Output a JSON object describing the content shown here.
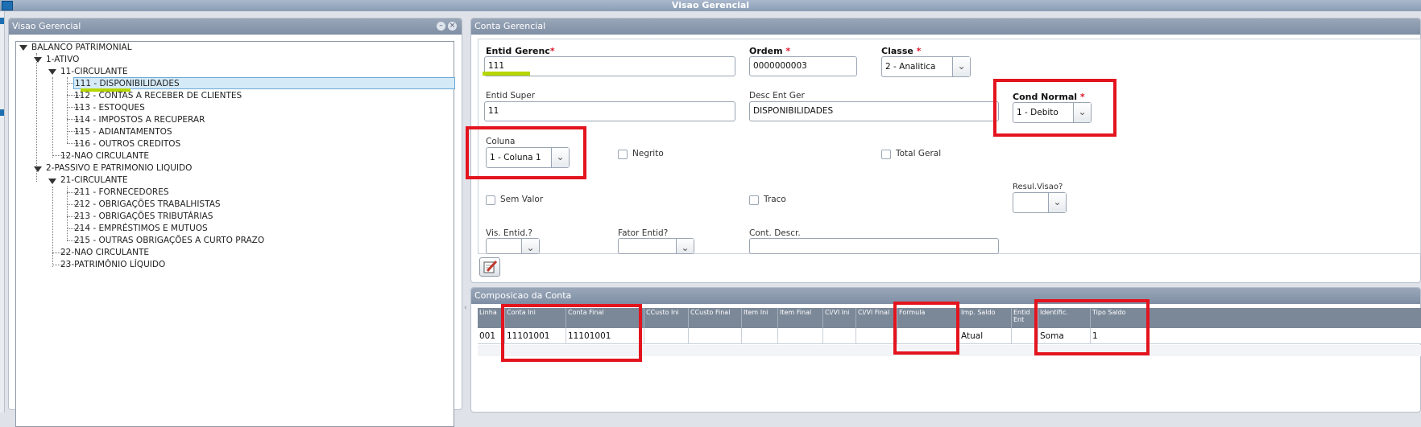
{
  "window": {
    "title": "Visao Gerencial"
  },
  "left_panel": {
    "title": "Visao Gerencial",
    "btn_min": "–",
    "btn_close": "×"
  },
  "tree": {
    "root": "BALANCO PATRIMONIAL",
    "n1": "1-ATIVO",
    "n11": "11-CIRCULANTE",
    "n111": "111 - DISPONIBILIDADES",
    "n112": "112 - CONTAS A RECEBER DE CLIENTES",
    "n113": "113 - ESTOQUES",
    "n114": "114 - IMPOSTOS A RECUPERAR",
    "n115": "115 - ADIANTAMENTOS",
    "n116": "116 - OUTROS CREDITOS",
    "n12": "12-NAO CIRCULANTE",
    "n2": "2-PASSIVO E PATRIMONIO LIQUIDO",
    "n21": "21-CIRCULANTE",
    "n211": "211 - FORNECEDORES",
    "n212": "212 - OBRIGAÇÕES TRABALHISTAS",
    "n213": "213 - OBRIGAÇÕES TRIBUTÁRIAS",
    "n214": "214 - EMPRÉSTIMOS E MUTUOS",
    "n215": "215 - OUTRAS OBRIGAÇÕES A CURTO PRAZO",
    "n22": "22-NAO CIRCULANTE",
    "n23": "23-PATRIMÔNIO LÍQUIDO"
  },
  "form_panel": {
    "title": "Conta Gerencial"
  },
  "form": {
    "entid_gerenc": {
      "label": "Entid Gerenc",
      "value": "111"
    },
    "ordem": {
      "label": "Ordem",
      "value": "0000000003"
    },
    "classe": {
      "label": "Classe",
      "value": "2 - Analitica"
    },
    "entid_super": {
      "label": "Entid Super",
      "value": "11"
    },
    "desc_ent_ger": {
      "label": "Desc Ent Ger",
      "value": "DISPONIBILIDADES"
    },
    "cond_normal": {
      "label": "Cond Normal",
      "value": "1 - Debito"
    },
    "coluna": {
      "label": "Coluna",
      "value": "1 - Coluna 1"
    },
    "negrito": {
      "label": "Negrito"
    },
    "total_geral": {
      "label": "Total Geral"
    },
    "sem_valor": {
      "label": "Sem Valor"
    },
    "traco": {
      "label": "Traco"
    },
    "resul_visao": {
      "label": "Resul.Visao?"
    },
    "vis_entid": {
      "label": "Vis. Entid.?"
    },
    "fator_entid": {
      "label": "Fator Entid?"
    },
    "cont_descr": {
      "label": "Cont. Descr."
    },
    "req_mark": "*"
  },
  "comp_panel": {
    "title": "Composicao da Conta"
  },
  "grid": {
    "headers": [
      "Linha",
      "Conta Ini",
      "Conta Final",
      "CCusto Ini",
      "CCusto Final",
      "Item Ini",
      "Item Final",
      "Cl/Vl Ini",
      "Cl/Vl Final",
      "Formula",
      "Imp. Saldo",
      "Entid Ent",
      "Identific.",
      "Tipo Saldo"
    ],
    "row": [
      "001",
      "11101001",
      "11101001",
      "",
      "",
      "",
      "",
      "",
      "",
      "",
      "Atual",
      "",
      "Soma",
      "1"
    ]
  }
}
